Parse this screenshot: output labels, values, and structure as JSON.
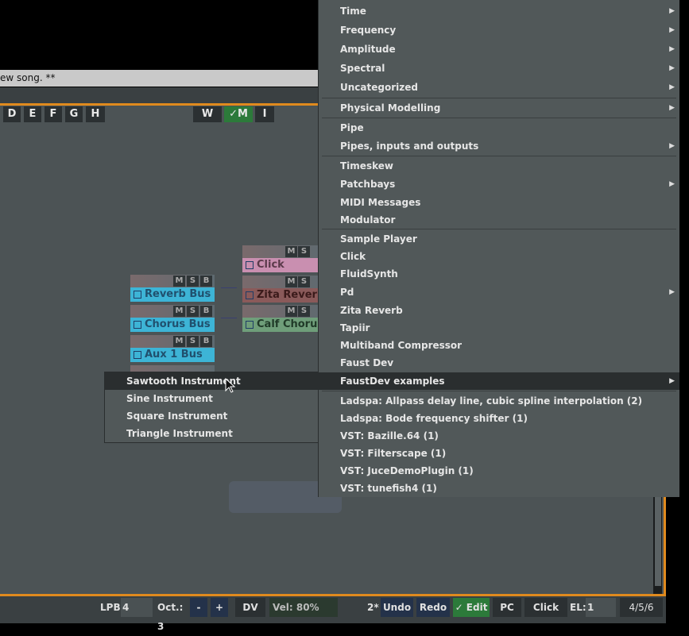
{
  "window": {
    "title": "ew song. **"
  },
  "toolbar": {
    "letters": [
      "D",
      "E",
      "F",
      "G",
      "H"
    ],
    "w": "W",
    "m": "✓M",
    "i": "I"
  },
  "mixer": {
    "click": "Click",
    "zita": "Zita Reverb",
    "calf": "Calf Chorus",
    "reverb_bus": "Reverb Bus",
    "chorus_bus": "Chorus Bus",
    "aux1_bus": "Aux 1 Bus",
    "m": "M",
    "s": "S",
    "b": "B"
  },
  "menu": {
    "items": [
      {
        "label": "Time",
        "sub": true
      },
      {
        "label": "Frequency",
        "sub": true
      },
      {
        "label": "Amplitude",
        "sub": true
      },
      {
        "label": "Spectral",
        "sub": true
      },
      {
        "label": "Uncategorized",
        "sub": true
      },
      {
        "label": "Physical Modelling",
        "sub": true
      },
      {
        "label": "Pipe",
        "sub": false
      },
      {
        "label": "Pipes, inputs and outputs",
        "sub": true
      },
      {
        "label": "Timeskew",
        "sub": false
      },
      {
        "label": "Patchbays",
        "sub": true
      },
      {
        "label": "MIDI Messages",
        "sub": false
      },
      {
        "label": "Modulator",
        "sub": false
      },
      {
        "label": "Sample Player",
        "sub": false
      },
      {
        "label": "Click",
        "sub": false
      },
      {
        "label": "FluidSynth",
        "sub": false
      },
      {
        "label": "Pd",
        "sub": true
      },
      {
        "label": "Zita Reverb",
        "sub": false
      },
      {
        "label": "Tapiir",
        "sub": false
      },
      {
        "label": "Multiband Compressor",
        "sub": false
      },
      {
        "label": "Faust Dev",
        "sub": false
      },
      {
        "label": "FaustDev examples",
        "sub": true
      },
      {
        "label": "Ladspa: Allpass delay line, cubic spline interpolation (2)",
        "sub": false
      },
      {
        "label": "Ladspa: Bode frequency shifter (1)",
        "sub": false
      },
      {
        "label": "VST: Bazille.64 (1)",
        "sub": false
      },
      {
        "label": "VST: Filterscape (1)",
        "sub": false
      },
      {
        "label": "VST: JuceDemoPlugin (1)",
        "sub": false
      },
      {
        "label": "VST: tunefish4 (1)",
        "sub": false
      }
    ],
    "arrow": "▶"
  },
  "submenu": {
    "items": [
      "Sawtooth Instrument",
      "Sine Instrument",
      "Square Instrument",
      "Triangle Instrument"
    ]
  },
  "bottom": {
    "lpb_label": "LPB",
    "lpb_value": "4",
    "oct_label": "Oct.: 3",
    "minus": "-",
    "plus": "+",
    "dv": "DV",
    "vel": "Vel: 80%",
    "undo_count": "2*",
    "undo": "Undo",
    "redo": "Redo",
    "edit": "✓ Edit",
    "pc": "PC",
    "click": "Click",
    "el_label": "EL:",
    "el_value": "1",
    "pos": "4/5/6"
  }
}
